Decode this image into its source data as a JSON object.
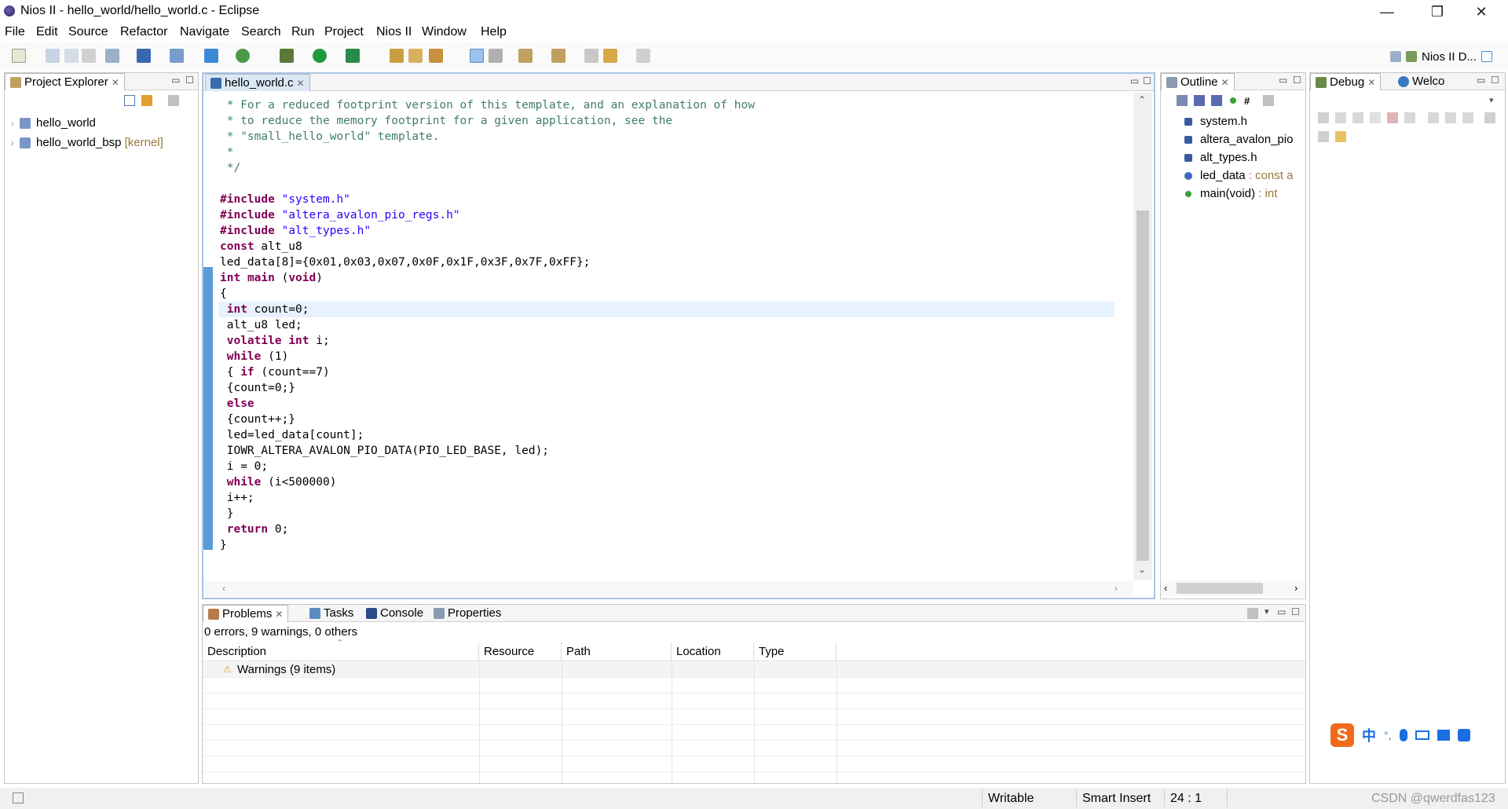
{
  "window": {
    "title": "Nios II - hello_world/hello_world.c - Eclipse",
    "minimize": "—",
    "restore": "❐",
    "close": "✕"
  },
  "menu": [
    "File",
    "Edit",
    "Source",
    "Refactor",
    "Navigate",
    "Search",
    "Run",
    "Project",
    "Nios II",
    "Window",
    "Help"
  ],
  "perspective": {
    "label": "Nios II D..."
  },
  "project_explorer": {
    "title": "Project Explorer",
    "items": [
      {
        "name": "hello_world",
        "tag": ""
      },
      {
        "name": "hello_world_bsp",
        "tag": "[kernel]"
      }
    ]
  },
  "editor": {
    "tab": "hello_world.c",
    "lines": [
      [
        {
          "c": "cm",
          "t": " * For a reduced footprint version of this template, and an explanation of how"
        }
      ],
      [
        {
          "c": "cm",
          "t": " * to reduce the memory footprint for a given application, see the"
        }
      ],
      [
        {
          "c": "cm",
          "t": " * \"small_hello_world\" template."
        }
      ],
      [
        {
          "c": "cm",
          "t": " *"
        }
      ],
      [
        {
          "c": "cm",
          "t": " */"
        }
      ],
      [
        {
          "c": "",
          "t": ""
        }
      ],
      [
        {
          "c": "kw",
          "t": "#include"
        },
        {
          "c": "",
          "t": " "
        },
        {
          "c": "st",
          "t": "\"system.h\""
        }
      ],
      [
        {
          "c": "kw",
          "t": "#include"
        },
        {
          "c": "",
          "t": " "
        },
        {
          "c": "st",
          "t": "\"altera_avalon_pio_regs.h\""
        }
      ],
      [
        {
          "c": "kw",
          "t": "#include"
        },
        {
          "c": "",
          "t": " "
        },
        {
          "c": "st",
          "t": "\"alt_types.h\""
        }
      ],
      [
        {
          "c": "kw",
          "t": "const"
        },
        {
          "c": "",
          "t": " alt_u8"
        }
      ],
      [
        {
          "c": "",
          "t": "led_data[8]={0x01,0x03,0x07,0x0F,0x1F,0x3F,0x7F,0xFF};"
        }
      ],
      [
        {
          "c": "kw",
          "t": "int"
        },
        {
          "c": "",
          "t": " "
        },
        {
          "c": "kw",
          "t": "main"
        },
        {
          "c": "",
          "t": " ("
        },
        {
          "c": "kw",
          "t": "void"
        },
        {
          "c": "",
          "t": ")"
        }
      ],
      [
        {
          "c": "",
          "t": "{"
        }
      ],
      [
        {
          "c": "",
          "t": " "
        },
        {
          "c": "kw",
          "t": "int"
        },
        {
          "c": "",
          "t": " count=0;"
        }
      ],
      [
        {
          "c": "",
          "t": " alt_u8 led;"
        }
      ],
      [
        {
          "c": "",
          "t": " "
        },
        {
          "c": "kw",
          "t": "volatile"
        },
        {
          "c": "",
          "t": " "
        },
        {
          "c": "kw",
          "t": "int"
        },
        {
          "c": "",
          "t": " i;"
        }
      ],
      [
        {
          "c": "",
          "t": " "
        },
        {
          "c": "kw",
          "t": "while"
        },
        {
          "c": "",
          "t": " (1)"
        }
      ],
      [
        {
          "c": "",
          "t": " { "
        },
        {
          "c": "kw",
          "t": "if"
        },
        {
          "c": "",
          "t": " (count==7)"
        }
      ],
      [
        {
          "c": "",
          "t": " {count=0;}"
        }
      ],
      [
        {
          "c": "",
          "t": " "
        },
        {
          "c": "kw",
          "t": "else"
        }
      ],
      [
        {
          "c": "",
          "t": " {count++;}"
        }
      ],
      [
        {
          "c": "",
          "t": " led=led_data[count];"
        }
      ],
      [
        {
          "c": "",
          "t": " IOWR_ALTERA_AVALON_PIO_DATA(PIO_LED_BASE, led);"
        }
      ],
      [
        {
          "c": "",
          "t": " i = 0;"
        }
      ],
      [
        {
          "c": "",
          "t": " "
        },
        {
          "c": "kw",
          "t": "while"
        },
        {
          "c": "",
          "t": " (i<500000)"
        }
      ],
      [
        {
          "c": "",
          "t": " i++;"
        }
      ],
      [
        {
          "c": "",
          "t": " }"
        }
      ],
      [
        {
          "c": "",
          "t": " "
        },
        {
          "c": "kw",
          "t": "return"
        },
        {
          "c": "",
          "t": " 0;"
        }
      ],
      [
        {
          "c": "",
          "t": "}"
        }
      ]
    ],
    "current_line": 13
  },
  "outline": {
    "title": "Outline",
    "items": [
      {
        "name": "system.h",
        "type": ""
      },
      {
        "name": "altera_avalon_pio",
        "type": ""
      },
      {
        "name": "alt_types.h",
        "type": ""
      },
      {
        "name": "led_data",
        "type": " : const a"
      },
      {
        "name": "main(void)",
        "type": " : int"
      }
    ]
  },
  "debug": {
    "tab1": "Debug",
    "tab2": "Welco"
  },
  "bottom": {
    "tabs": [
      "Problems",
      "Tasks",
      "Console",
      "Properties"
    ],
    "summary": "0 errors, 9 warnings, 0 others",
    "columns": [
      "Description",
      "Resource",
      "Path",
      "Location",
      "Type"
    ],
    "rows": [
      {
        "description": "Warnings (9 items)"
      }
    ]
  },
  "ime": {
    "items": [
      "中",
      "°,",
      "🎤",
      "⌨",
      "👕",
      "▦"
    ]
  },
  "status": {
    "writable": "Writable",
    "insert": "Smart Insert",
    "position": "24 : 1",
    "watermark": "CSDN @qwerdfas123"
  }
}
